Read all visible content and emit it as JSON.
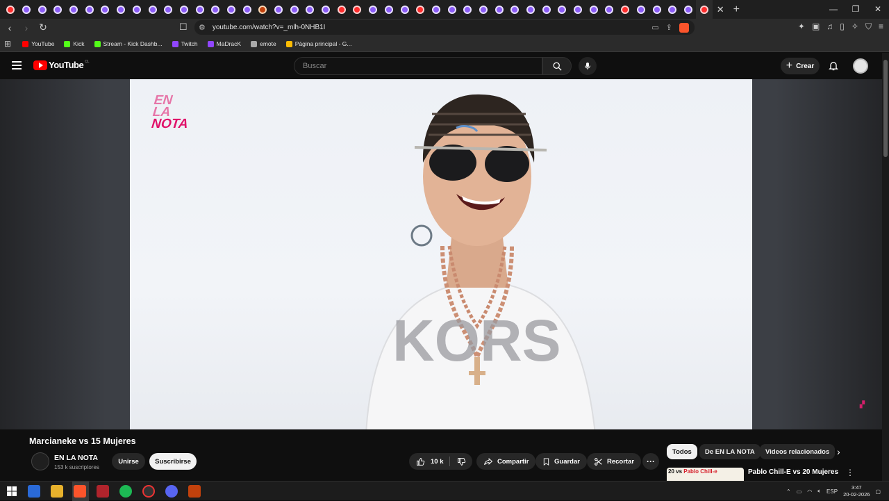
{
  "browser": {
    "url": "youtube.com/watch?v=_mlh-0NHB1I",
    "bookmarks": [
      {
        "label": "YouTube",
        "color": "#ff0000"
      },
      {
        "label": "Kick",
        "color": "#53fc18"
      },
      {
        "label": "Stream - Kick Dashb...",
        "color": "#53fc18"
      },
      {
        "label": "Twitch",
        "color": "#9146ff"
      },
      {
        "label": "MaDracK",
        "color": "#9146ff"
      },
      {
        "label": "emote",
        "color": "#aaaaaa"
      },
      {
        "label": "Página principal - G...",
        "color": "#fbbc04"
      }
    ]
  },
  "youtube": {
    "logo_text": "YouTube",
    "country_code": "CL",
    "search_placeholder": "Buscar",
    "create_label": "Crear"
  },
  "video": {
    "overlay_brand": [
      "EN",
      "LA",
      "NOTA"
    ],
    "title": "Marcianeke vs 15 Mujeres",
    "channel": "EN LA NOTA",
    "subscribers": "153 k suscriptores",
    "join_label": "Unirse",
    "subscribe_label": "Suscribirse",
    "likes": "10 k",
    "share_label": "Compartir",
    "save_label": "Guardar",
    "clip_label": "Recortar"
  },
  "related": {
    "chips": [
      "Todos",
      "De EN LA NOTA",
      "Videos relacionados"
    ],
    "first_video_title": "Pablo Chill-E vs 20 Mujeres",
    "first_video_thumb_text_a": "20 vs ",
    "first_video_thumb_text_b": "Pablo Chill-e"
  },
  "taskbar": {
    "language": "ESP",
    "time": "3:47",
    "date": "20-02-2026"
  },
  "colors": {
    "youtube_red": "#ff0000",
    "brand_pink": "#e0136a",
    "dark_bg": "#0f0f0f"
  }
}
